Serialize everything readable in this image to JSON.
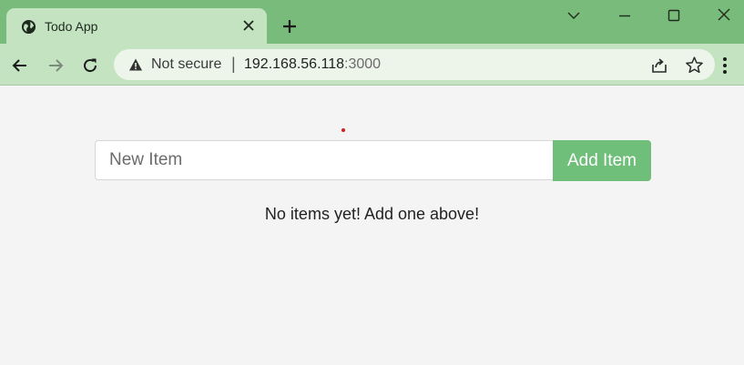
{
  "browser": {
    "tab": {
      "title": "Todo App",
      "icon": "globe-icon"
    },
    "address_bar": {
      "security_label": "Not secure",
      "separator": "|",
      "host": "192.168.56.118",
      "port": ":3000"
    },
    "window_controls": [
      "chevron-down-icon",
      "minimize-icon",
      "maximize-icon",
      "close-icon"
    ]
  },
  "app": {
    "input_placeholder": "New Item",
    "input_value": "",
    "add_button_label": "Add Item",
    "empty_message": "No items yet! Add one above!"
  },
  "colors": {
    "browser_frame": "#79bb7a",
    "toolbar": "#c3e3c1",
    "add_button": "#6fbf7b",
    "page_background": "#f4f4f4"
  }
}
